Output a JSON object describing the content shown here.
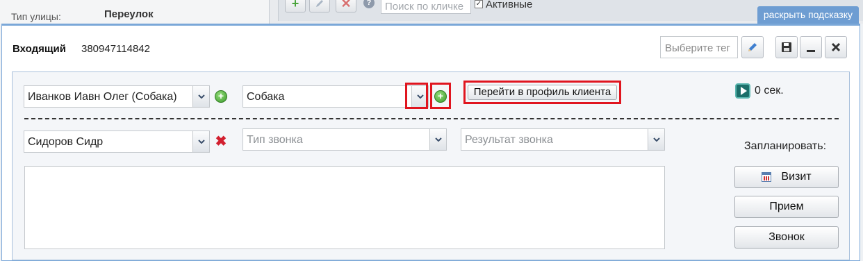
{
  "background": {
    "street_label": "Тип улицы:",
    "street_value": "Переулок",
    "toolbar": {
      "add_icon": "plus-icon",
      "edit_icon": "pencil-icon",
      "delete_icon": "x-icon",
      "help_glyph": "?",
      "search_placeholder": "Поиск по кличке",
      "active_label": "Активные",
      "active_checked": true
    }
  },
  "hint_tab": "раскрыть подсказку",
  "dialog": {
    "title": "Входящий",
    "phone": "380947114842",
    "tag_placeholder": "Выберите тег",
    "buttons": {
      "tag_edit": "pencil-icon",
      "save": "floppy-icon",
      "minimize": "minimize-icon",
      "close": "close-icon"
    }
  },
  "form": {
    "client_select": "Иванков Иавн Олег (Собака)",
    "pet_select": "Собака",
    "profile_button": "Перейти в профиль клиента",
    "timer": "0 сек.",
    "doctor_select": "Сидоров Сидр",
    "call_type_placeholder": "Тип звонка",
    "call_result_placeholder": "Результат звонка",
    "note_value": "",
    "schedule_label": "Запланировать:",
    "schedule_buttons": [
      "Визит",
      "Прием",
      "Звонок"
    ]
  },
  "colors": {
    "accent_blue": "#7aa7d8",
    "highlight_red": "#e0151f",
    "add_green": "#3c9a2c",
    "remove_red": "#d21f2f"
  }
}
